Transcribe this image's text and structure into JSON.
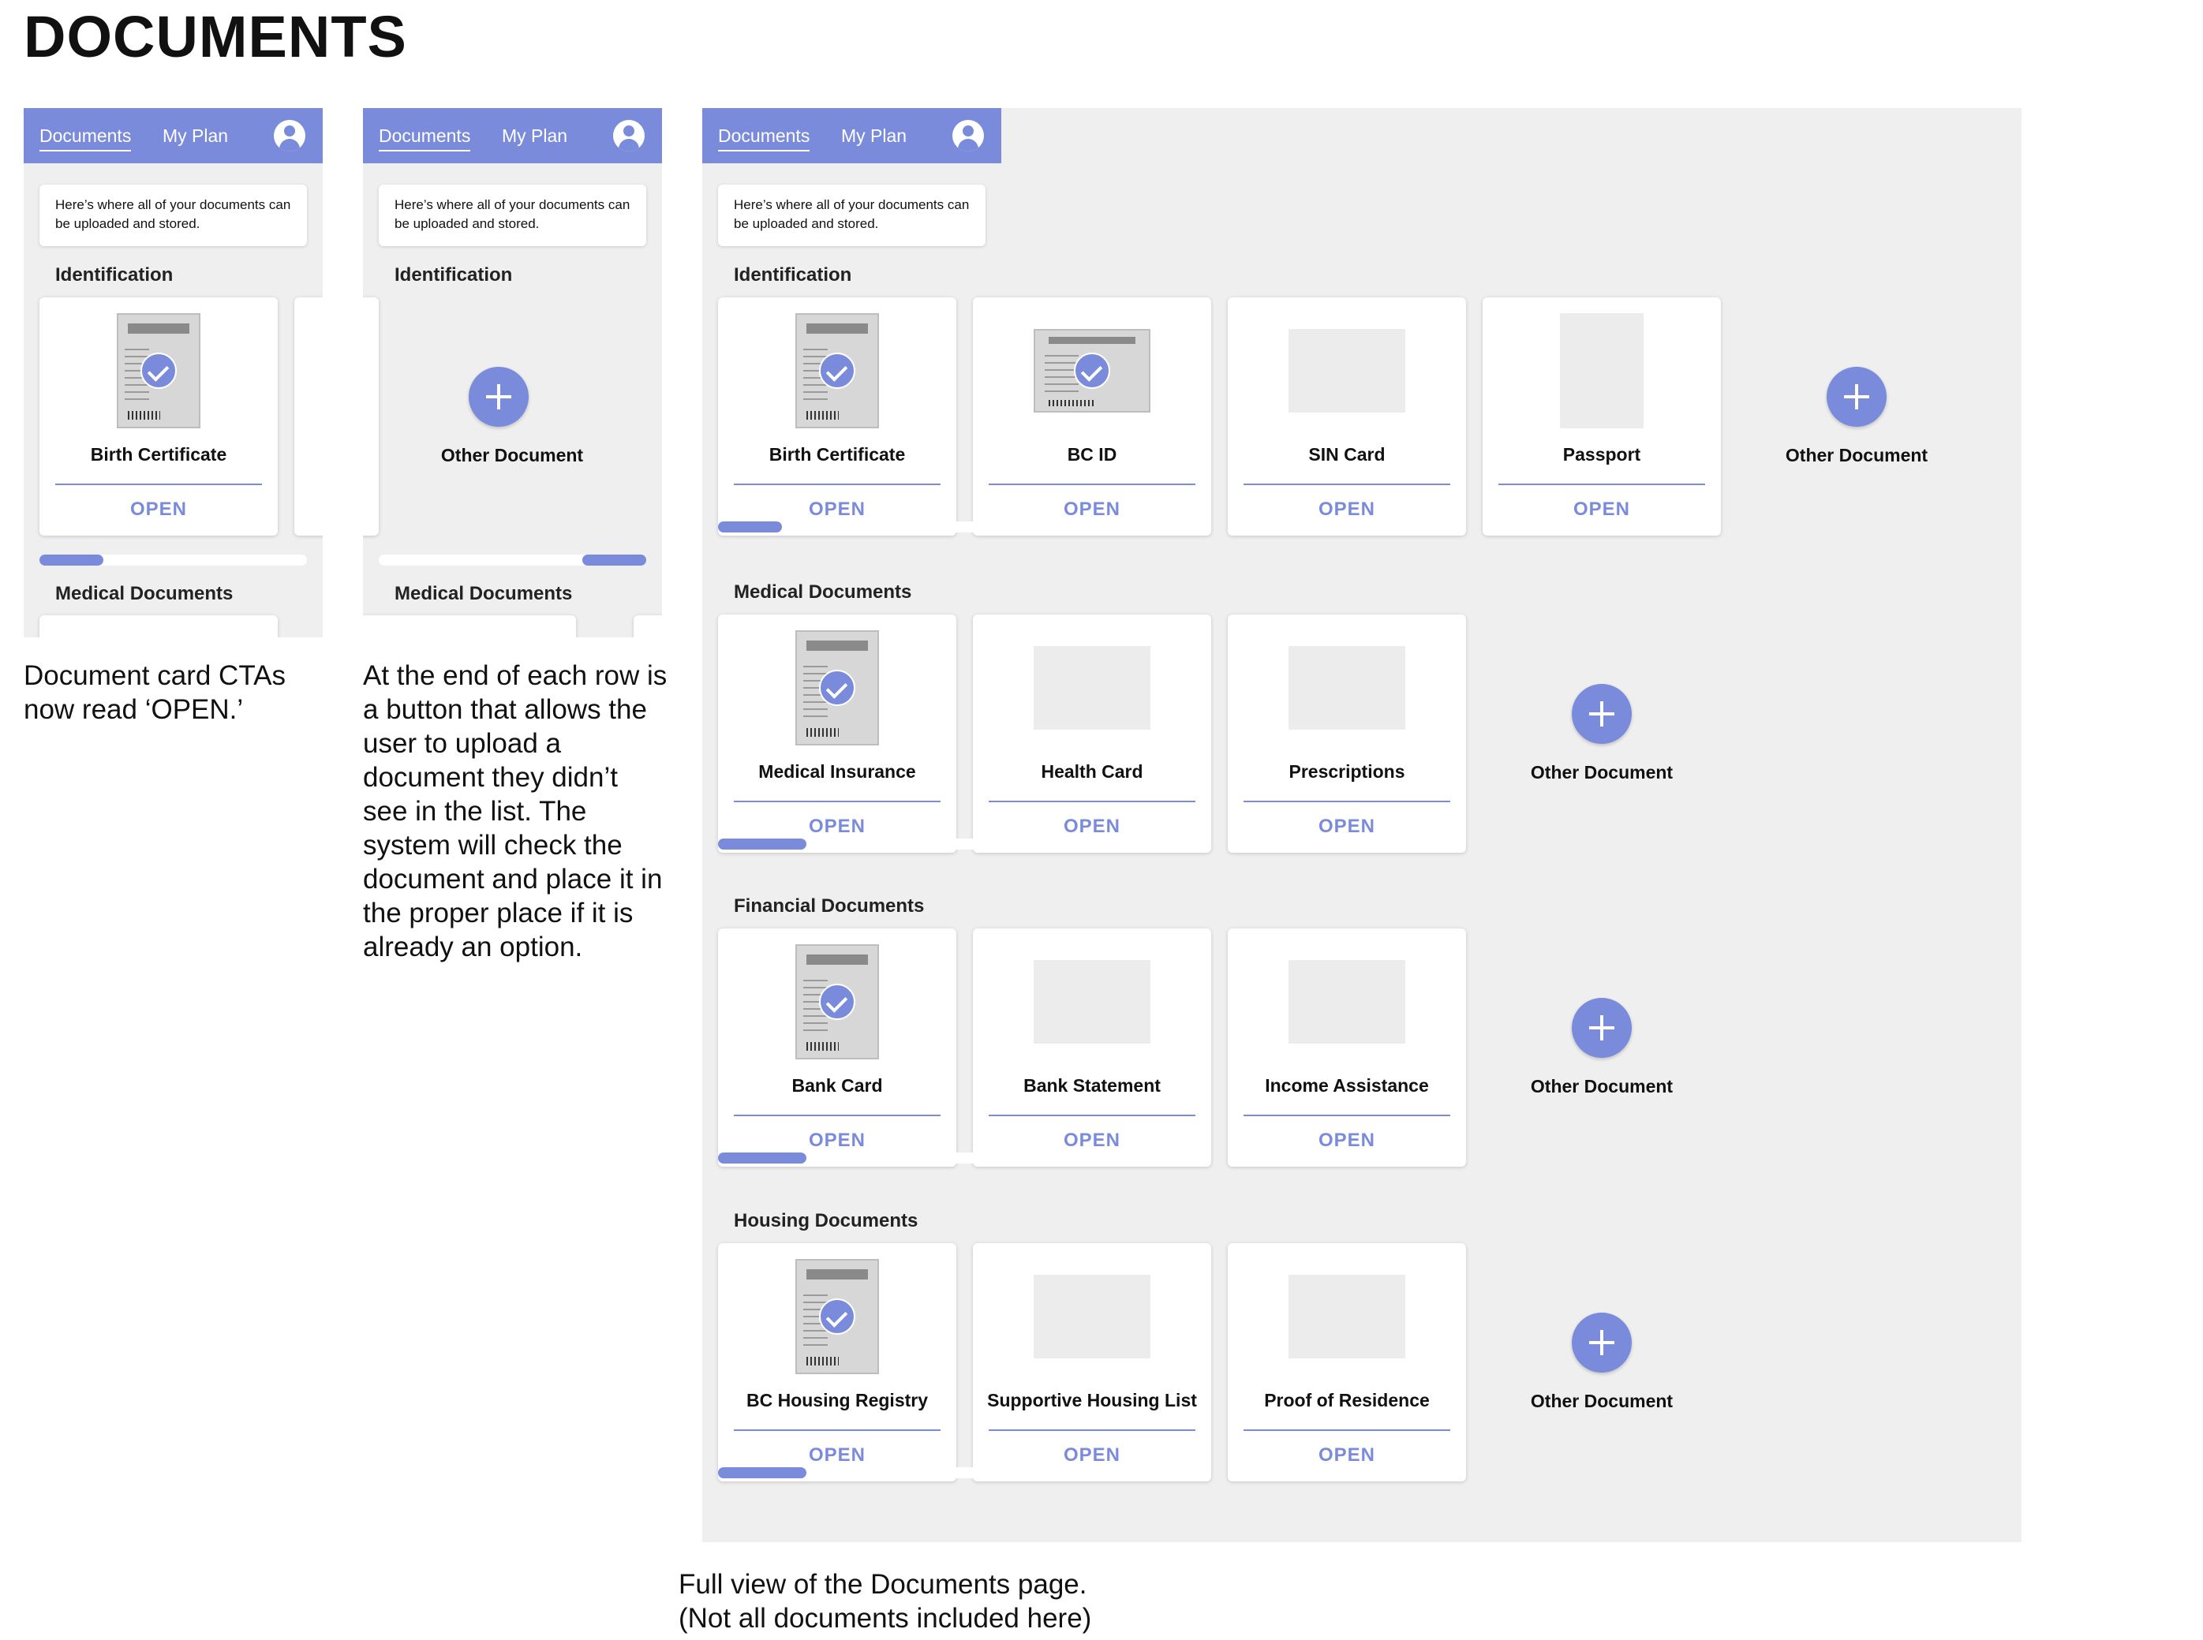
{
  "page_title": "DOCUMENTS",
  "nav": {
    "documents": "Documents",
    "plan": "My Plan"
  },
  "intro_text": "Here’s where all of your documents can be uploaded and stored.",
  "open_label": "OPEN",
  "add_label": "Other Document",
  "mobile": {
    "section_identification": "Identification",
    "section_medical": "Medical Documents",
    "birth_certificate": "Birth Certificate",
    "scroll_panel1": 0.24,
    "scroll_panel2": 0.24
  },
  "sections": [
    {
      "title": "Identification",
      "scroll_fraction": 0.24,
      "cards": [
        {
          "name": "Birth Certificate",
          "uploaded": true
        },
        {
          "name": "BC ID",
          "uploaded": true
        },
        {
          "name": "SIN Card",
          "uploaded": false
        },
        {
          "name": "Passport",
          "uploaded": false
        }
      ]
    },
    {
      "title": "Medical Documents",
      "scroll_fraction": 0.33,
      "cards": [
        {
          "name": "Medical Insurance",
          "uploaded": true
        },
        {
          "name": "Health Card",
          "uploaded": false
        },
        {
          "name": "Prescriptions",
          "uploaded": false
        }
      ]
    },
    {
      "title": "Financial Documents",
      "scroll_fraction": 0.33,
      "cards": [
        {
          "name": "Bank Card",
          "uploaded": true
        },
        {
          "name": "Bank Statement",
          "uploaded": false
        },
        {
          "name": "Income Assistance",
          "uploaded": false
        }
      ]
    },
    {
      "title": "Housing Documents",
      "scroll_fraction": 0.33,
      "cards": [
        {
          "name": "BC Housing Registry",
          "uploaded": true
        },
        {
          "name": "Supportive Housing List",
          "uploaded": false
        },
        {
          "name": "Proof of Residence",
          "uploaded": false
        }
      ]
    }
  ],
  "captions": {
    "card_ctas": [
      "Document card CTAs",
      "now read ‘OPEN.’"
    ],
    "end_of_row": [
      "At the end of each row is",
      "a button that allows the",
      "user to upload a",
      "document they didn’t",
      "see in the list. The",
      "system will check the",
      "document and place it in",
      "the proper place if it is",
      "already an option."
    ],
    "full_view": [
      "Full view of the Documents page.",
      "(Not all documents included here)"
    ]
  },
  "colors": {
    "accent": "#7a8bdc",
    "panel_bg": "#efefef"
  }
}
